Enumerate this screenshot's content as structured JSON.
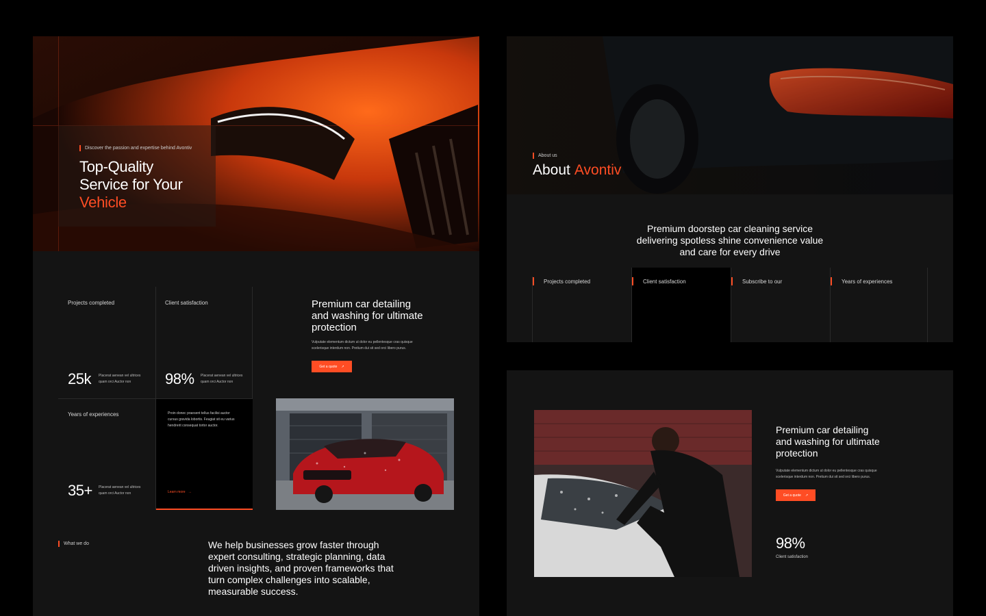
{
  "hero": {
    "kicker": "Discover the passion and expertise behind Avontiv",
    "title_line1": "Top-Quality",
    "title_line2": "Service for Your",
    "title_accent": "Vehicle"
  },
  "stats_left": {
    "projects": {
      "label": "Projects completed",
      "value": "25",
      "suffix": "k",
      "desc_line1": "Placerat aenean vel ultrices",
      "desc_line2": "quam orci Auctor non"
    },
    "satisfaction": {
      "label": "Client satisfaction",
      "value": "98",
      "suffix": "%",
      "desc_line1": "Placerat aenean vel ultrices",
      "desc_line2": "quam orci Auctor non"
    },
    "years": {
      "label": "Years of experiences",
      "value": "35",
      "suffix": "+",
      "desc_line1": "Placerat aenean vel ultrices",
      "desc_line2": "quam orci Auctor non"
    }
  },
  "detailing_card": {
    "title_line1": "Premium car detailing",
    "title_line2": "and washing for ultimate",
    "title_line3": "protection",
    "body_line1": "Vulputate elementum dictum ut dolor eu pellentesque cras quisque",
    "body_line2": "scelerisque interdum non. Pretium dui sit sed orci libero purus.",
    "button": "Get a quote",
    "button_icon": "↗"
  },
  "promo_card": {
    "body_line1": "Proin donec praesent tellus facilisi auctor",
    "body_line2": "cursus gravida lobortis. Feugiat sit eu varius",
    "body_line3": "hendrerit consequat tortor auctor.",
    "link": "Learn more",
    "link_icon": "→"
  },
  "what_we_do": {
    "kicker": "What we do",
    "line1": "We help businesses grow faster through",
    "line2": "expert consulting, strategic planning, data",
    "line3": "driven insights, and proven frameworks that",
    "line4": "turn complex challenges into scalable,",
    "line5": "measurable success."
  },
  "about": {
    "kicker": "About us",
    "title": "About",
    "title_accent": "Avontiv",
    "statement_line1": "Premium doorstep car cleaning service",
    "statement_line2": "delivering spotless shine convenience value",
    "statement_line3": "and care for every drive",
    "tabs": [
      "Projects completed",
      "Client satisfaction",
      "Subscribe to our",
      "Years of experiences"
    ]
  },
  "bottom_card": {
    "title_line1": "Premium car detailing",
    "title_line2": "and washing for ultimate",
    "title_line3": "protection",
    "body_line1": "Vulputate elementum dictum ut dolor eu pellentesque cras quisque",
    "body_line2": "scelerisque interdum non. Pretium dui sit sed orci libero purus.",
    "button": "Get a quote",
    "button_icon": "↗",
    "stat_value": "98",
    "stat_suffix": "%",
    "stat_label": "Client satisfaction"
  },
  "colors": {
    "accent": "#ff4d24",
    "panel": "#141414",
    "background": "#000000"
  }
}
